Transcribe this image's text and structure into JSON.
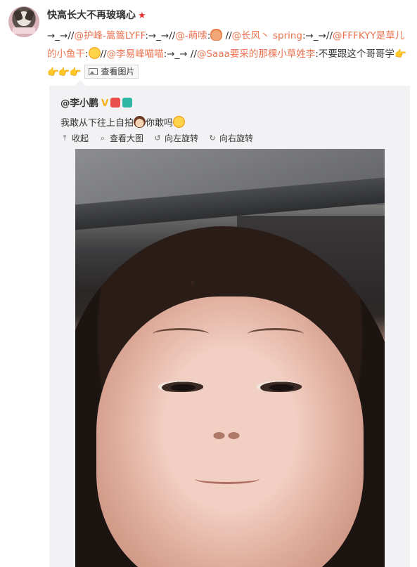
{
  "post": {
    "author": "快高长大不再玻璃心",
    "author_badge": "★",
    "text_segments": [
      {
        "t": "→_→//"
      },
      {
        "t": "@护峰-篙篙LYFF",
        "at": true
      },
      {
        "t": ":→_→//"
      },
      {
        "t": "@-萌嗦",
        "at": true
      },
      {
        "t": ":"
      },
      {
        "emoji": "cake-emoji"
      },
      {
        "t": " //"
      },
      {
        "t": "@长风丶 spring",
        "at": true
      },
      {
        "t": ":→_→//"
      },
      {
        "t": "@FFFKYY是草儿的小鱼干",
        "at": true
      },
      {
        "t": ":"
      },
      {
        "emoji": "laugh-emoji"
      },
      {
        "t": "//"
      },
      {
        "t": "@李易峰喵喵",
        "at": true
      },
      {
        "t": ":→_→ //"
      },
      {
        "t": "@Saaa要采的那棵小草姓李",
        "at": true
      },
      {
        "t": ":不要跟这个哥哥学"
      },
      {
        "hands": "👉👉👉👉"
      }
    ],
    "view_image_label": "查看图片"
  },
  "repost": {
    "author": "@李小鹏",
    "v_badge": "V",
    "text_before": "我敢从下往上自拍",
    "text_after": "你敢吗",
    "toolbar": [
      {
        "icon": "collapse-icon",
        "glyph": "⤒",
        "label": "收起"
      },
      {
        "icon": "search-icon",
        "glyph": "⌕",
        "label": "查看大图"
      },
      {
        "icon": "rotate-left-icon",
        "glyph": "↺",
        "label": "向左旋转"
      },
      {
        "icon": "rotate-right-icon",
        "glyph": "↻",
        "label": "向右旋转"
      }
    ]
  },
  "colors": {
    "link": "#eb7350",
    "repost_bg": "#f2f2f5",
    "badge_star": "#e8312c",
    "v_badge": "#f5b21a"
  }
}
